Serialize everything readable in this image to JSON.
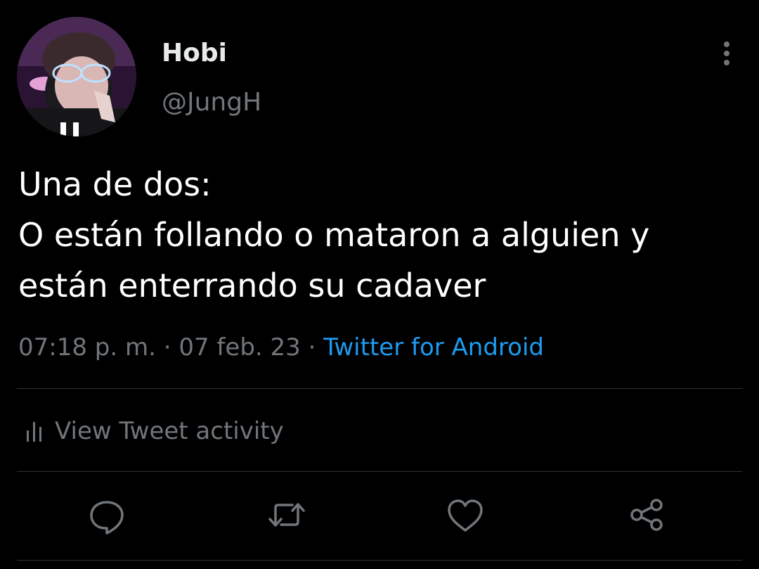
{
  "author": {
    "display_name": "Hobi",
    "handle": "@JungH",
    "avatar_icon": "profile-photo"
  },
  "tweet": {
    "lines": [
      "Una de dos:",
      "O están follando o mataron a alguien y",
      "están enterrando su cadaver"
    ]
  },
  "meta": {
    "time": "07:18 p. m.",
    "separator": "·",
    "date": "07 feb. 23",
    "source": "Twitter for Android"
  },
  "activity": {
    "label": "View Tweet activity",
    "icon": "bar-chart-icon"
  },
  "actions": [
    {
      "name": "reply",
      "icon": "comment-icon"
    },
    {
      "name": "retweet",
      "icon": "retweet-icon"
    },
    {
      "name": "like",
      "icon": "heart-icon"
    },
    {
      "name": "share",
      "icon": "share-icon"
    }
  ],
  "colors": {
    "background": "#000000",
    "primary_text": "#ffffff",
    "secondary_text": "#71767b",
    "link": "#1d9bf0",
    "divider": "#2f3336"
  }
}
